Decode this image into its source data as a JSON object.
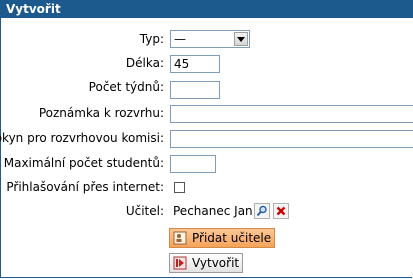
{
  "panel": {
    "title": "Vytvořit"
  },
  "form": {
    "typ": {
      "label": "Typ:",
      "selected": "—"
    },
    "delka": {
      "label": "Délka:",
      "value": "45"
    },
    "pocet_tydnu": {
      "label": "Počet týdnů:",
      "value": ""
    },
    "poznamka": {
      "label": "Poznámka k rozvrhu:",
      "value": ""
    },
    "pokyn": {
      "label": "Pokyn pro rozvrhovou komisi:",
      "value": ""
    },
    "max_studentu": {
      "label": "Maximální počet studentů:",
      "value": ""
    },
    "prihlasovani": {
      "label": "Přihlašování přes internet:",
      "checked": false
    },
    "ucitel": {
      "label": "Učitel:",
      "value": "Pechanec Jan"
    }
  },
  "buttons": {
    "add_teacher": "Přidat učitele",
    "create": "Vytvořit"
  },
  "icons": {
    "search": "search-icon",
    "remove": "remove-icon",
    "add_teacher": "add-person-icon",
    "create": "create-icon"
  },
  "colors": {
    "title_bar": "#1c5a8e",
    "add_button": "#f8b070",
    "create_button": "#eeeeee",
    "remove_icon": "#cc0000"
  }
}
